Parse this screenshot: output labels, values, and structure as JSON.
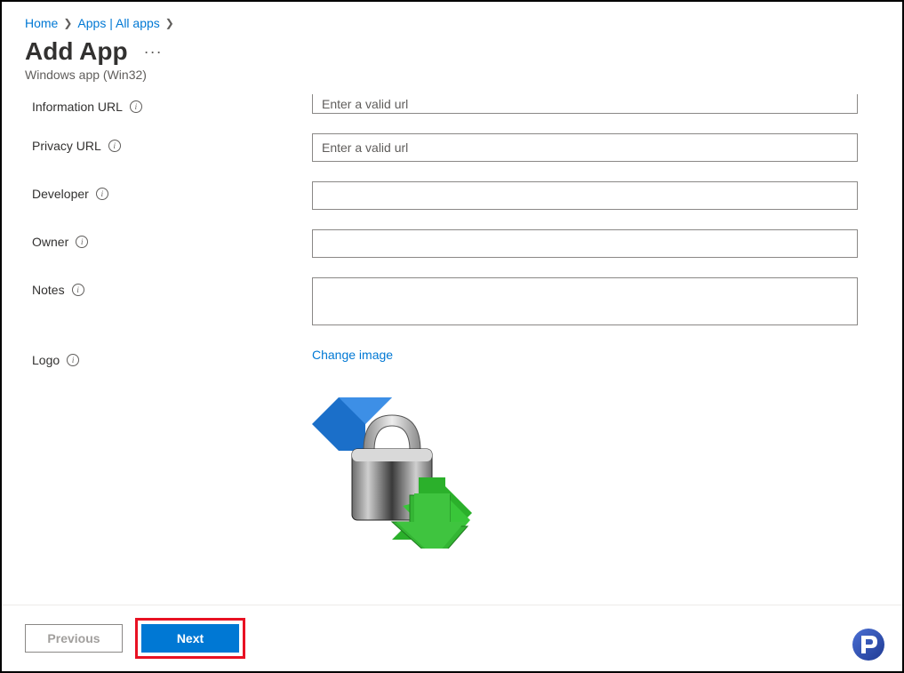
{
  "breadcrumb": {
    "home": "Home",
    "apps": "Apps | All apps"
  },
  "page": {
    "title": "Add App",
    "subtitle": "Windows app (Win32)"
  },
  "form": {
    "information_url": {
      "label": "Information URL",
      "placeholder": "Enter a valid url",
      "value": ""
    },
    "privacy_url": {
      "label": "Privacy URL",
      "placeholder": "Enter a valid url",
      "value": ""
    },
    "developer": {
      "label": "Developer",
      "placeholder": "",
      "value": ""
    },
    "owner": {
      "label": "Owner",
      "placeholder": "",
      "value": ""
    },
    "notes": {
      "label": "Notes",
      "placeholder": "",
      "value": ""
    },
    "logo": {
      "label": "Logo",
      "change_link": "Change image"
    }
  },
  "buttons": {
    "previous": "Previous",
    "next": "Next"
  }
}
